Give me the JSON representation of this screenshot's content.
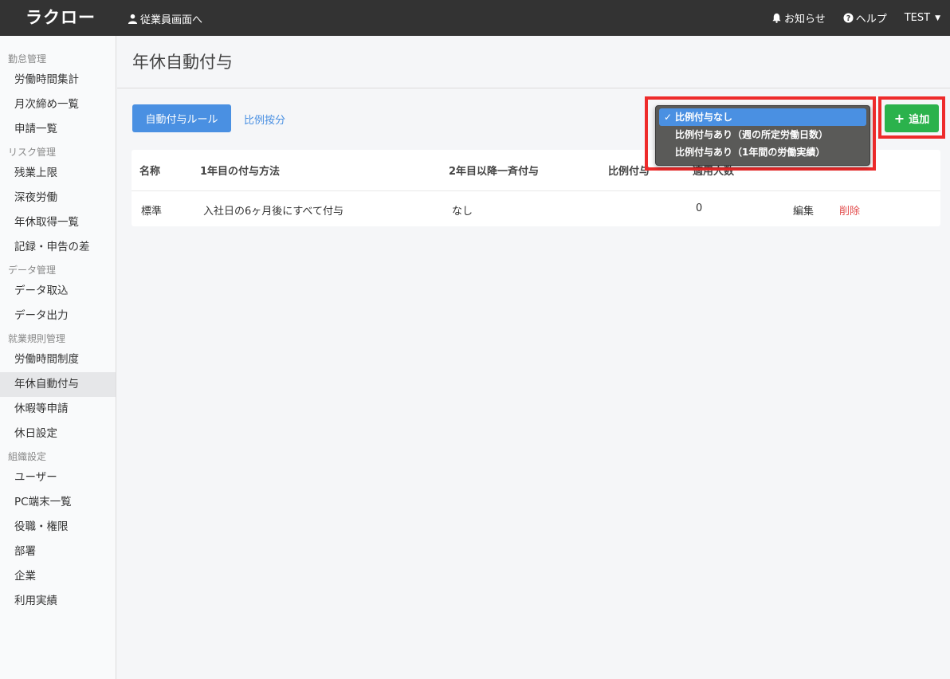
{
  "header": {
    "logo": "ラクロー",
    "employee_link": "従業員画面へ",
    "notifications": "お知らせ",
    "help": "ヘルプ",
    "user": "TEST"
  },
  "sidebar": {
    "sections": [
      {
        "title": "勤怠管理",
        "items": [
          "労働時間集計",
          "月次締め一覧",
          "申請一覧"
        ]
      },
      {
        "title": "リスク管理",
        "items": [
          "残業上限",
          "深夜労働",
          "年休取得一覧",
          "記録・申告の差"
        ]
      },
      {
        "title": "データ管理",
        "items": [
          "データ取込",
          "データ出力"
        ]
      },
      {
        "title": "就業規則管理",
        "items": [
          "労働時間制度",
          "年休自動付与",
          "休暇等申請",
          "休日設定"
        ]
      },
      {
        "title": "組織設定",
        "items": [
          "ユーザー",
          "PC端末一覧",
          "役職・権限",
          "部署",
          "企業",
          "利用実績"
        ]
      }
    ],
    "active_item": "年休自動付与"
  },
  "main": {
    "page_title": "年休自動付与",
    "rule_button": "自動付与ルール",
    "ratio_link": "比例按分",
    "add_button": "追加",
    "table": {
      "headers": [
        "名称",
        "1年目の付与方法",
        "2年目以降一斉付与",
        "比例付与",
        "適用人数"
      ],
      "rows": [
        {
          "name": "標準",
          "first_year": "入社日の6ヶ月後にすべて付与",
          "second_year": "なし",
          "ratio": "",
          "count": "0",
          "edit": "編集",
          "delete": "削除"
        }
      ]
    },
    "dropdown": {
      "options": [
        "比例付与なし",
        "比例付与あり（週の所定労働日数）",
        "比例付与あり（1年間の労働実績）"
      ],
      "selected_index": 0
    }
  },
  "colors": {
    "topbar": "#333333",
    "primary": "#4a90e2",
    "success": "#2bb24c",
    "danger": "#e24b4b",
    "highlight": "#ee2b2b"
  }
}
